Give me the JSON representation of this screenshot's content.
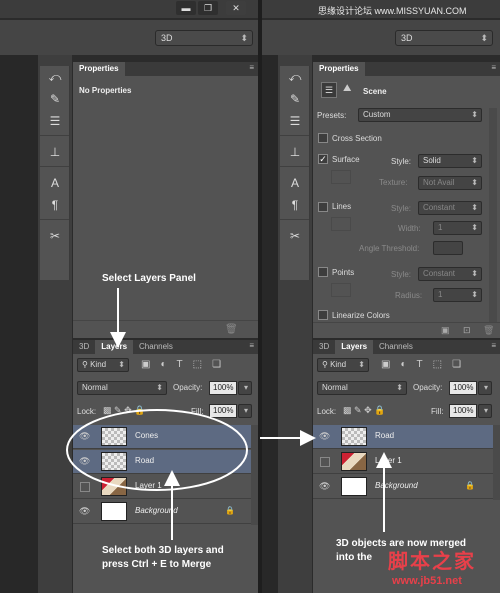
{
  "window": {
    "minimize": "▬",
    "restore": "❐",
    "close": "✕"
  },
  "workspace_select": {
    "value": "3D",
    "arrow": "⬍"
  },
  "toolstrip_icons": [
    "history-icon",
    "brush-preset-icon",
    "adjustment-icon",
    "align-icon",
    "character-icon",
    "paragraph-icon",
    "tools-preset-icon"
  ],
  "left": {
    "properties": {
      "tab": "Properties",
      "header": "No Properties"
    },
    "layers_tabs": [
      "3D",
      "Layers",
      "Channels"
    ],
    "filter": {
      "kind": "Kind"
    },
    "blend": "Normal",
    "opacity_label": "Opacity:",
    "opacity_value": "100%",
    "lock_label": "Lock:",
    "fill_label": "Fill:",
    "fill_value": "100%",
    "layers": [
      {
        "name": "Cones",
        "selected": true,
        "visible": true
      },
      {
        "name": "Road",
        "selected": true,
        "visible": true
      },
      {
        "name": "Layer 1",
        "selected": false,
        "visible": false
      },
      {
        "name": "Background",
        "selected": false,
        "visible": true
      }
    ]
  },
  "right": {
    "properties": {
      "tab": "Properties",
      "header": "Scene",
      "presets_label": "Presets:",
      "presets_value": "Custom",
      "cross_section": "Cross Section",
      "surface": "Surface",
      "surface_style_label": "Style:",
      "surface_style_value": "Solid",
      "texture_label": "Texture:",
      "texture_value": "Not Avail",
      "lines": "Lines",
      "lines_style_label": "Style:",
      "lines_style_value": "Constant",
      "width_label": "Width:",
      "width_value": "1",
      "angle_label": "Angle Threshold:",
      "points": "Points",
      "points_style_label": "Style:",
      "points_style_value": "Constant",
      "radius_label": "Radius:",
      "radius_value": "1",
      "linearize": "Linearize Colors"
    },
    "layers_tabs": [
      "3D",
      "Layers",
      "Channels"
    ],
    "filter": {
      "kind": "Kind"
    },
    "blend": "Normal",
    "opacity_label": "Opacity:",
    "opacity_value": "100%",
    "lock_label": "Lock:",
    "fill_label": "Fill:",
    "fill_value": "100%",
    "layers": [
      {
        "name": "Road",
        "selected": true,
        "visible": true
      },
      {
        "name": "Layer 1",
        "selected": false,
        "visible": false
      },
      {
        "name": "Background",
        "selected": false,
        "visible": true
      }
    ]
  },
  "annotations": {
    "select_layers": "Select Layers Panel",
    "merge": "Select both 3D layers and press Ctrl + E to Merge",
    "merged": "3D objects are now merged into the",
    "watermark_cn": "脚本之家",
    "watermark_url": "www.jb51.net",
    "watermark_top": "思缘设计论坛 www.MISSYUAN.COM"
  }
}
